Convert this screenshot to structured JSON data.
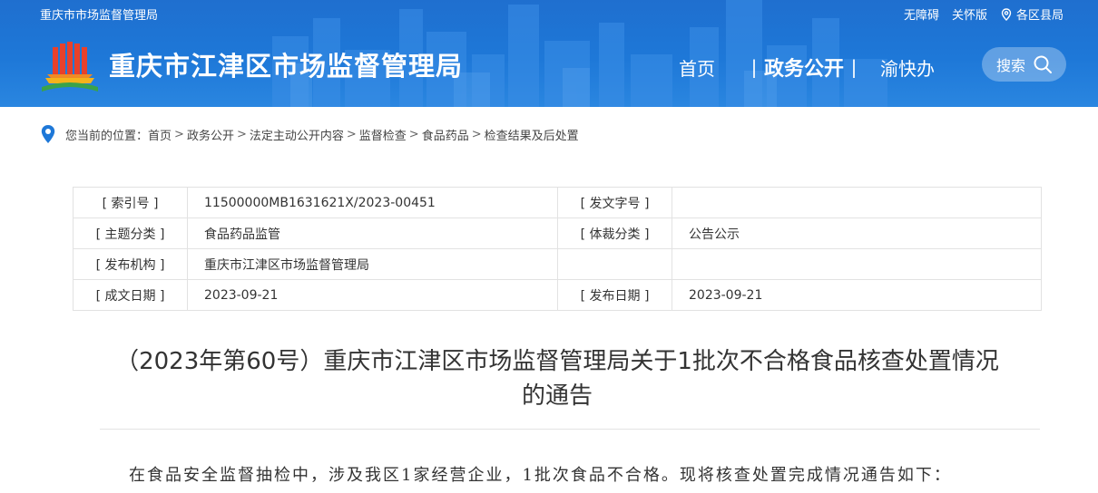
{
  "header": {
    "top_site": "重庆市市场监督管理局",
    "top_links": [
      "无障碍",
      "关怀版",
      "各区县局"
    ],
    "org_name": "重庆市江津区市场监督管理局",
    "nav": {
      "home": "首页",
      "sep": "|",
      "active": "政务公开",
      "yu": "渝快办"
    },
    "search_label": "搜索",
    "colors": {
      "bg": "#1e78d8",
      "logo_red": "#e8412b",
      "logo_yellow": "#f5b21b",
      "logo_green": "#3aa24a"
    }
  },
  "breadcrumb": {
    "prefix": "您当前的位置：",
    "items": [
      "首页",
      "政务公开",
      "法定主动公开内容",
      "监督检查",
      "食品药品",
      "检查结果及后处置"
    ],
    "separator": ">"
  },
  "info": {
    "rows": [
      {
        "k1": "[ 索引号 ]",
        "v1": "11500000MB1631621X/2023-00451",
        "k2": "[ 发文字号 ]",
        "v2": ""
      },
      {
        "k1": "[ 主题分类 ]",
        "v1": "食品药品监管",
        "k2": "[ 体裁分类 ]",
        "v2": "公告公示"
      },
      {
        "k1": "[ 发布机构 ]",
        "v1": "重庆市江津区市场监督管理局",
        "k2": "",
        "v2": ""
      },
      {
        "k1": "[ 成文日期 ]",
        "v1": "2023-09-21",
        "k2": "[ 发布日期 ]",
        "v2": "2023-09-21"
      }
    ]
  },
  "doc": {
    "title_line1": "（2023年第60号）重庆市江津区市场监督管理局关于1批次不合格食品核查处置情况",
    "title_line2": "的通告",
    "body": "在食品安全监督抽检中，涉及我区1家经营企业，1批次食品不合格。现将核查处置完成情况通告如下："
  }
}
